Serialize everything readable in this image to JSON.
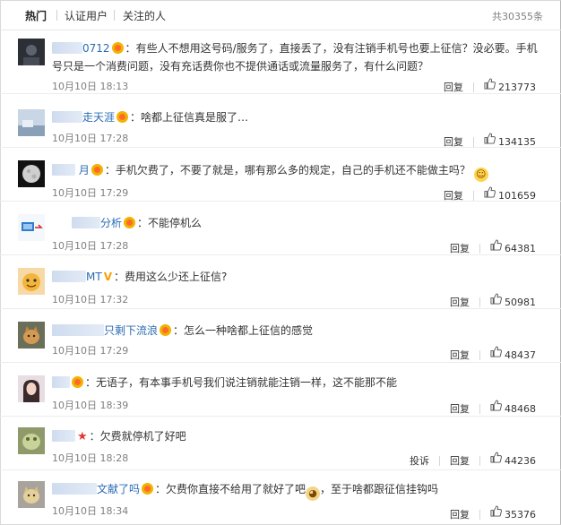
{
  "tabs": [
    {
      "label": "热门"
    },
    {
      "label": "认证用户"
    },
    {
      "label": "关注的人"
    }
  ],
  "total_label": "共30355条",
  "actions": {
    "reply": "回复",
    "report": "投诉"
  },
  "comments": [
    {
      "user_suffix": "0712",
      "text": "有些人不想用这号码/服务了，直接丢了，没有注销手机号也要上征信？没必要。手机号只是一个消费问题，没有充话费你也不提供通话或流量服务了，有什么问题？",
      "time": "10月10日 18:13",
      "likes": "213773",
      "avatar_icon": "dark-avatar"
    },
    {
      "user_suffix": "走天涯",
      "text": "啥都上征信真是服了…",
      "time": "10月10日 17:28",
      "likes": "134135",
      "avatar_icon": "landscape-avatar"
    },
    {
      "user_suffix": "月",
      "text": "手机欠费了，不要了就是，哪有那么多的规定，自己的手机还不能做主吗？",
      "time": "10月10日 17:29",
      "likes": "101659",
      "avatar_icon": "moon-avatar"
    },
    {
      "user_suffix": "分析",
      "text": "不能停机么",
      "time": "10月10日 17:28",
      "likes": "64381",
      "avatar_icon": "logo-avatar"
    },
    {
      "user_suffix": "MT",
      "text": "费用这么少还上征信?",
      "time": "10月10日 17:32",
      "likes": "50981",
      "avatar_icon": "cartoon-avatar"
    },
    {
      "user_suffix": "只剩下流浪",
      "text": "怎么一种啥都上征信的感觉",
      "time": "10月10日 17:29",
      "likes": "48437",
      "avatar_icon": "cat-avatar"
    },
    {
      "user_suffix": "",
      "text": "无语子，有本事手机号我们说注销就能注销一样，这不能那不能",
      "time": "10月10日 18:39",
      "likes": "48468",
      "avatar_icon": "portrait-avatar"
    },
    {
      "user_suffix": "",
      "text": "欠费就停机了好吧",
      "time": "10月10日 18:28",
      "likes": "44236",
      "avatar_icon": "plant-avatar"
    },
    {
      "user_suffix": "文献了吗",
      "text_before": "欠费你直接不给用了就好了吧",
      "text_after": "，至于啥都跟征信挂钩吗",
      "time": "10月10日 18:34",
      "likes": "35376",
      "avatar_icon": "kitten-avatar"
    }
  ]
}
